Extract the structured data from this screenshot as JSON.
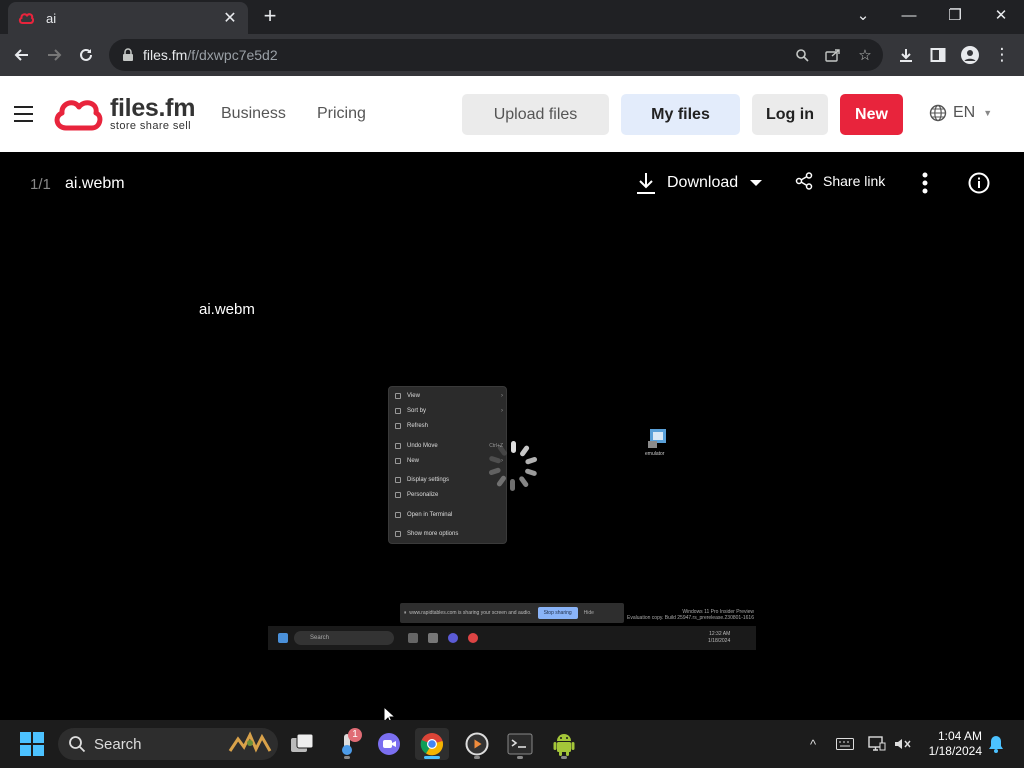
{
  "browser": {
    "tab_title": "ai",
    "url_host": "files.fm",
    "url_path": "/f/dxwpc7e5d2"
  },
  "site": {
    "logo_main": "files.fm",
    "logo_sub": "store share sell",
    "nav": [
      "Business",
      "Pricing"
    ],
    "buttons": {
      "upload": "Upload files",
      "myfiles": "My files",
      "login": "Log in",
      "new": "New"
    },
    "lang": "EN",
    "colors": {
      "accent": "#e8243c",
      "myfiles_bg": "#e3ecfb",
      "upload_bg": "#ebebeb"
    }
  },
  "viewer": {
    "counter": "1/1",
    "file_name": "ai.webm",
    "download_label": "Download",
    "share_label": "Share link",
    "video_title": "ai.webm"
  },
  "video_frame": {
    "menu_items": [
      {
        "label": "View",
        "suffix": "›"
      },
      {
        "label": "Sort by",
        "suffix": "›"
      },
      {
        "label": "Refresh",
        "suffix": ""
      },
      {
        "label": "Undo Move",
        "suffix": "Ctrl+Z"
      },
      {
        "label": "New",
        "suffix": "›"
      },
      {
        "label": "Display settings",
        "suffix": ""
      },
      {
        "label": "Personalize",
        "suffix": ""
      },
      {
        "label": "Open in Terminal",
        "suffix": ""
      },
      {
        "label": "Show more options",
        "suffix": ""
      }
    ],
    "desktop_icon_label": "emulator",
    "share_bar_text": "www.rapidtables.com is sharing your screen and audio.",
    "stop_sharing": "Stop sharing",
    "hide": "Hide",
    "watermark_line1": "Windows 11 Pro Insider Preview",
    "watermark_line2": "Evaluation copy. Build 25947.rs_prerelease.230801-1616",
    "mini_search": "Search",
    "mini_time": "12:32 AM",
    "mini_date": "1/18/2024"
  },
  "taskbar": {
    "search": "Search",
    "badge": "1",
    "time": "1:04 AM",
    "date": "1/18/2024"
  }
}
